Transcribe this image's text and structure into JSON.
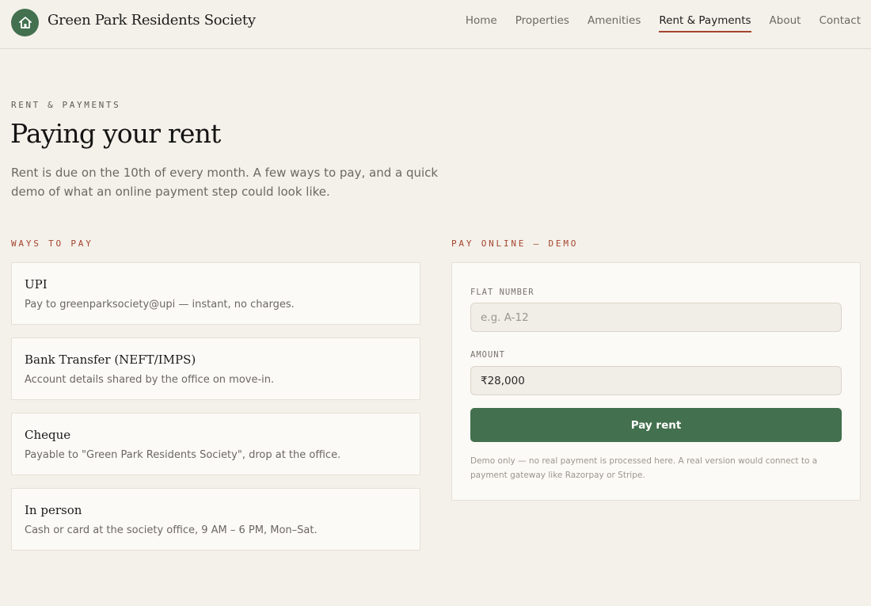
{
  "header": {
    "brand": "Green Park Residents Society",
    "nav": [
      "Home",
      "Properties",
      "Amenities",
      "Rent & Payments",
      "About",
      "Contact"
    ],
    "active_nav": "Rent & Payments"
  },
  "page": {
    "eyebrow": "RENT & PAYMENTS",
    "title": "Paying your rent",
    "intro": "Rent is due on the 10th of every month. A few ways to pay, and a quick demo of what an online payment step could look like."
  },
  "ways": {
    "label": "WAYS TO PAY",
    "items": [
      {
        "title": "UPI",
        "desc": "Pay to greenparksociety@upi — instant, no charges."
      },
      {
        "title": "Bank Transfer (NEFT/IMPS)",
        "desc": "Account details shared by the office on move-in."
      },
      {
        "title": "Cheque",
        "desc": "Payable to \"Green Park Residents Society\", drop at the office."
      },
      {
        "title": "In person",
        "desc": "Cash or card at the society office, 9 AM – 6 PM, Mon–Sat."
      }
    ]
  },
  "pay_online": {
    "label": "PAY ONLINE — DEMO",
    "flat_label": "FLAT NUMBER",
    "flat_placeholder": "e.g. A-12",
    "flat_value": "",
    "amount_label": "AMOUNT",
    "amount_value": "₹28,000",
    "button": "Pay rent",
    "note": "Demo only — no real payment is processed here. A real version would connect to a payment gateway like Razorpay or Stripe."
  },
  "colors": {
    "background": "#f4f1ea",
    "brand_green": "#43704e",
    "accent_rust": "#a4452f",
    "card": "#fcfaf6"
  },
  "icons": {
    "logo": "house-icon"
  }
}
